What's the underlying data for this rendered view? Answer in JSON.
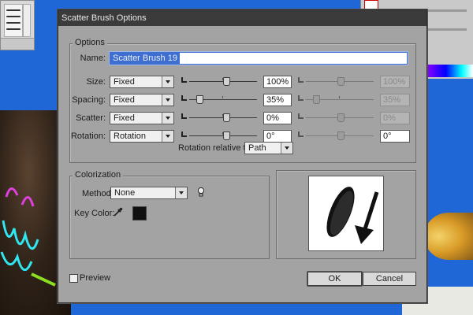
{
  "dialog": {
    "title": "Scatter Brush Options"
  },
  "options": {
    "legend": "Options",
    "name_label": "Name:",
    "name_value": "Scatter Brush 19",
    "rows": [
      {
        "label": "Size:",
        "mode": "Fixed",
        "value": "100%",
        "value2": "100%",
        "slider_fraction": 0.54,
        "slider2_fraction": 0.5
      },
      {
        "label": "Spacing:",
        "mode": "Fixed",
        "value": "35%",
        "value2": "35%",
        "slider_fraction": 0.14,
        "slider2_fraction": 0.14
      },
      {
        "label": "Scatter:",
        "mode": "Fixed",
        "value": "0%",
        "value2": "0%",
        "slider_fraction": 0.54,
        "slider2_fraction": 0.5
      },
      {
        "label": "Rotation:",
        "mode": "Rotation",
        "value": "0°",
        "value2": "0°",
        "slider_fraction": 0.54,
        "slider2_fraction": 0.5
      }
    ],
    "rotation_relative_label": "Rotation relative to:",
    "rotation_relative_value": "Path"
  },
  "colorization": {
    "legend": "Colorization",
    "method_label": "Method:",
    "method_value": "None",
    "key_color_label": "Key Color:",
    "key_color": "#111111"
  },
  "footer": {
    "preview_label": "Preview",
    "preview_checked": false,
    "ok_label": "OK",
    "cancel_label": "Cancel"
  },
  "icons": [
    "tip-lightbulb-icon",
    "eyedropper-icon",
    "dropdown-arrow-icon",
    "slider-mode-icon",
    "brush-preview-icon"
  ]
}
